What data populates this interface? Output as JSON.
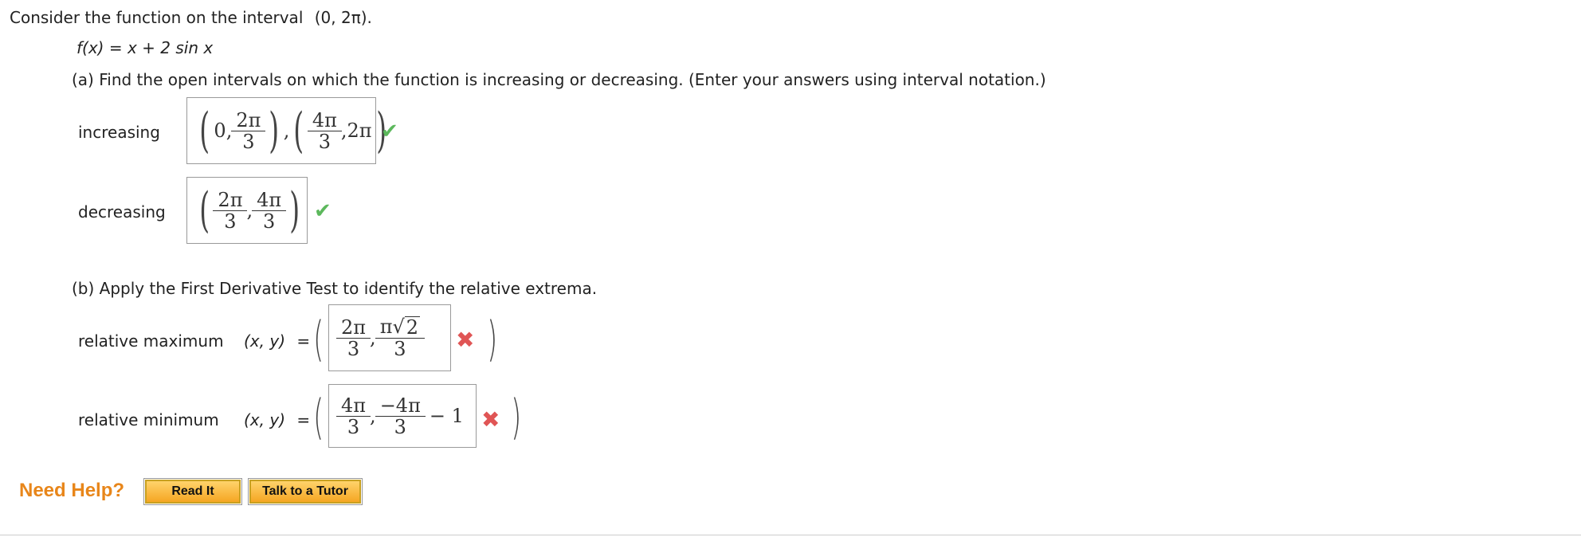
{
  "intro": {
    "text": "Consider the function on the interval",
    "interval": "(0, 2π)."
  },
  "function": {
    "lhs": "f(x) = x + 2 sin x"
  },
  "part_a": {
    "prompt": "(a) Find the open intervals on which the function is increasing or decreasing. (Enter your answers using interval notation.)",
    "increasing": {
      "label": "increasing",
      "answer": {
        "open1": "(",
        "a1": "0,",
        "f1_num": "2π",
        "f1_den": "3",
        "close1": ")",
        "sep": ",",
        "open2": "(",
        "f2_num": "4π",
        "f2_den": "3",
        "b2": ",2π",
        "close2": ")"
      },
      "status": "correct"
    },
    "decreasing": {
      "label": "decreasing",
      "answer": {
        "open": "(",
        "f1_num": "2π",
        "f1_den": "3",
        "sep": ",",
        "f2_num": "4π",
        "f2_den": "3",
        "close": ")"
      },
      "status": "correct"
    }
  },
  "part_b": {
    "prompt": "(b) Apply the First Derivative Test to identify the relative extrema.",
    "maximum": {
      "label": "relative maximum",
      "xy_label": "(x, y)",
      "equals": "=",
      "open": "(",
      "close": ")",
      "answer": {
        "f1_num": "2π",
        "f1_den": "3",
        "sep": ",",
        "f2_num_a": "π",
        "f2_sqrt": "2",
        "f2_den": "3"
      },
      "status": "incorrect"
    },
    "minimum": {
      "label": "relative minimum",
      "xy_label": "(x, y)",
      "equals": "=",
      "open": "(",
      "close": ")",
      "answer": {
        "f1_num": "4π",
        "f1_den": "3",
        "sep": ",",
        "f2_num": "−4π",
        "f2_den": "3",
        "tail": "− 1"
      },
      "status": "incorrect"
    }
  },
  "help": {
    "label": "Need Help?",
    "read_it": "Read It",
    "tutor": "Talk to a Tutor"
  },
  "icons": {
    "correct": "check-icon",
    "incorrect": "x-icon"
  },
  "colors": {
    "correct": "#5cb85c",
    "incorrect": "#e05555",
    "help": "#e8861a",
    "button": "#f5a623"
  }
}
